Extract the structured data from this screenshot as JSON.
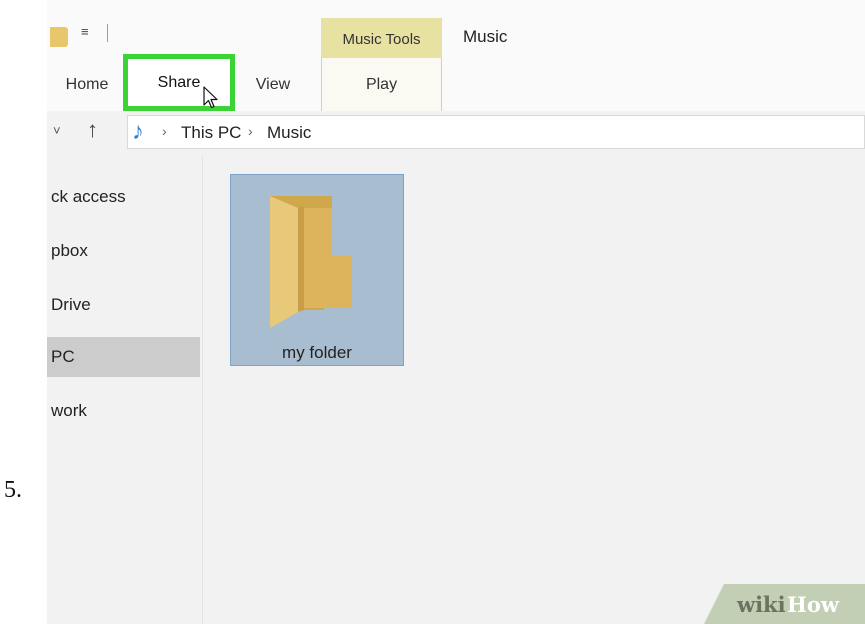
{
  "step_number": "5.",
  "window": {
    "title": "Music",
    "quick_access_dropdown": "≡",
    "context_tab": "Music Tools"
  },
  "ribbon": {
    "tabs": [
      {
        "label": "Home"
      },
      {
        "label": "Share",
        "highlighted": true
      },
      {
        "label": "View"
      },
      {
        "label": "Play"
      }
    ]
  },
  "address_bar": {
    "down_glyph": "˅",
    "up_glyph": "↑",
    "separator": "›",
    "breadcrumbs": [
      "This PC",
      "Music"
    ]
  },
  "nav_pane": {
    "items": [
      "ck access",
      "pbox",
      "Drive",
      "PC",
      "work"
    ],
    "selected": "PC"
  },
  "content": {
    "items": [
      {
        "label": "my folder",
        "selected": true
      }
    ]
  },
  "watermark": {
    "part1": "wiki",
    "part2": "How"
  },
  "colors": {
    "highlight_border": "#3bd437",
    "context_tab": "#e7e2a1",
    "selection": "#a9bdd0",
    "folder": "#e3c26f"
  }
}
